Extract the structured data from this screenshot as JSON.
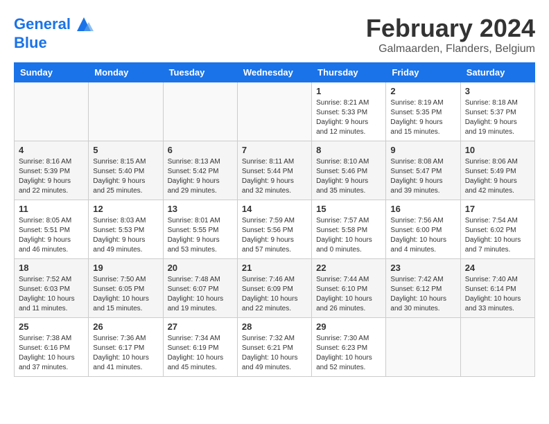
{
  "header": {
    "logo_line1": "General",
    "logo_line2": "Blue",
    "month_title": "February 2024",
    "location": "Galmaarden, Flanders, Belgium"
  },
  "days_of_week": [
    "Sunday",
    "Monday",
    "Tuesday",
    "Wednesday",
    "Thursday",
    "Friday",
    "Saturday"
  ],
  "weeks": [
    [
      {
        "day": "",
        "info": ""
      },
      {
        "day": "",
        "info": ""
      },
      {
        "day": "",
        "info": ""
      },
      {
        "day": "",
        "info": ""
      },
      {
        "day": "1",
        "info": "Sunrise: 8:21 AM\nSunset: 5:33 PM\nDaylight: 9 hours\nand 12 minutes."
      },
      {
        "day": "2",
        "info": "Sunrise: 8:19 AM\nSunset: 5:35 PM\nDaylight: 9 hours\nand 15 minutes."
      },
      {
        "day": "3",
        "info": "Sunrise: 8:18 AM\nSunset: 5:37 PM\nDaylight: 9 hours\nand 19 minutes."
      }
    ],
    [
      {
        "day": "4",
        "info": "Sunrise: 8:16 AM\nSunset: 5:39 PM\nDaylight: 9 hours\nand 22 minutes."
      },
      {
        "day": "5",
        "info": "Sunrise: 8:15 AM\nSunset: 5:40 PM\nDaylight: 9 hours\nand 25 minutes."
      },
      {
        "day": "6",
        "info": "Sunrise: 8:13 AM\nSunset: 5:42 PM\nDaylight: 9 hours\nand 29 minutes."
      },
      {
        "day": "7",
        "info": "Sunrise: 8:11 AM\nSunset: 5:44 PM\nDaylight: 9 hours\nand 32 minutes."
      },
      {
        "day": "8",
        "info": "Sunrise: 8:10 AM\nSunset: 5:46 PM\nDaylight: 9 hours\nand 35 minutes."
      },
      {
        "day": "9",
        "info": "Sunrise: 8:08 AM\nSunset: 5:47 PM\nDaylight: 9 hours\nand 39 minutes."
      },
      {
        "day": "10",
        "info": "Sunrise: 8:06 AM\nSunset: 5:49 PM\nDaylight: 9 hours\nand 42 minutes."
      }
    ],
    [
      {
        "day": "11",
        "info": "Sunrise: 8:05 AM\nSunset: 5:51 PM\nDaylight: 9 hours\nand 46 minutes."
      },
      {
        "day": "12",
        "info": "Sunrise: 8:03 AM\nSunset: 5:53 PM\nDaylight: 9 hours\nand 49 minutes."
      },
      {
        "day": "13",
        "info": "Sunrise: 8:01 AM\nSunset: 5:55 PM\nDaylight: 9 hours\nand 53 minutes."
      },
      {
        "day": "14",
        "info": "Sunrise: 7:59 AM\nSunset: 5:56 PM\nDaylight: 9 hours\nand 57 minutes."
      },
      {
        "day": "15",
        "info": "Sunrise: 7:57 AM\nSunset: 5:58 PM\nDaylight: 10 hours\nand 0 minutes."
      },
      {
        "day": "16",
        "info": "Sunrise: 7:56 AM\nSunset: 6:00 PM\nDaylight: 10 hours\nand 4 minutes."
      },
      {
        "day": "17",
        "info": "Sunrise: 7:54 AM\nSunset: 6:02 PM\nDaylight: 10 hours\nand 7 minutes."
      }
    ],
    [
      {
        "day": "18",
        "info": "Sunrise: 7:52 AM\nSunset: 6:03 PM\nDaylight: 10 hours\nand 11 minutes."
      },
      {
        "day": "19",
        "info": "Sunrise: 7:50 AM\nSunset: 6:05 PM\nDaylight: 10 hours\nand 15 minutes."
      },
      {
        "day": "20",
        "info": "Sunrise: 7:48 AM\nSunset: 6:07 PM\nDaylight: 10 hours\nand 19 minutes."
      },
      {
        "day": "21",
        "info": "Sunrise: 7:46 AM\nSunset: 6:09 PM\nDaylight: 10 hours\nand 22 minutes."
      },
      {
        "day": "22",
        "info": "Sunrise: 7:44 AM\nSunset: 6:10 PM\nDaylight: 10 hours\nand 26 minutes."
      },
      {
        "day": "23",
        "info": "Sunrise: 7:42 AM\nSunset: 6:12 PM\nDaylight: 10 hours\nand 30 minutes."
      },
      {
        "day": "24",
        "info": "Sunrise: 7:40 AM\nSunset: 6:14 PM\nDaylight: 10 hours\nand 33 minutes."
      }
    ],
    [
      {
        "day": "25",
        "info": "Sunrise: 7:38 AM\nSunset: 6:16 PM\nDaylight: 10 hours\nand 37 minutes."
      },
      {
        "day": "26",
        "info": "Sunrise: 7:36 AM\nSunset: 6:17 PM\nDaylight: 10 hours\nand 41 minutes."
      },
      {
        "day": "27",
        "info": "Sunrise: 7:34 AM\nSunset: 6:19 PM\nDaylight: 10 hours\nand 45 minutes."
      },
      {
        "day": "28",
        "info": "Sunrise: 7:32 AM\nSunset: 6:21 PM\nDaylight: 10 hours\nand 49 minutes."
      },
      {
        "day": "29",
        "info": "Sunrise: 7:30 AM\nSunset: 6:23 PM\nDaylight: 10 hours\nand 52 minutes."
      },
      {
        "day": "",
        "info": ""
      },
      {
        "day": "",
        "info": ""
      }
    ]
  ]
}
